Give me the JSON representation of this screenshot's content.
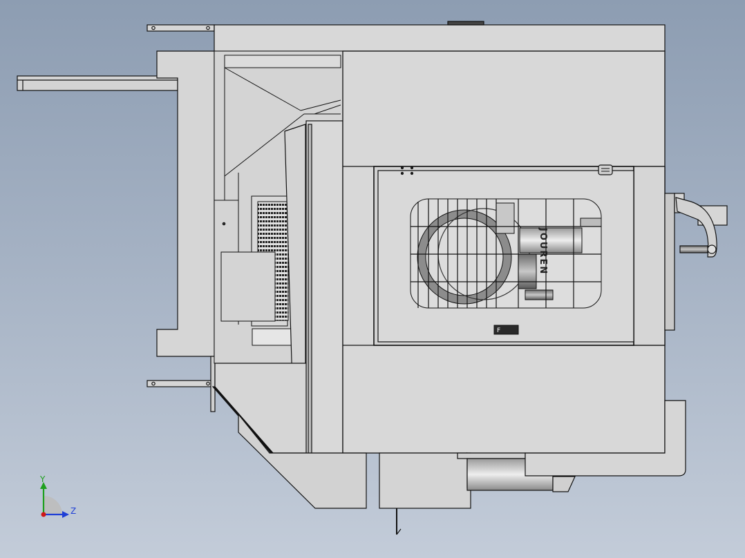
{
  "scene": {
    "background_top": "#8d9db2",
    "background_bottom": "#c3ccd9",
    "part_fill": "#d6d6d6",
    "part_fill_dark": "#b8b8b8",
    "edge_color": "#111111"
  },
  "panel": {
    "brand_text": "JOUREN",
    "badge_text": "F"
  },
  "triad": {
    "y_label": "Y",
    "z_label": "Z",
    "y_color": "#1ea01e",
    "z_color": "#1f3fd6",
    "x_color": "#d01818"
  }
}
